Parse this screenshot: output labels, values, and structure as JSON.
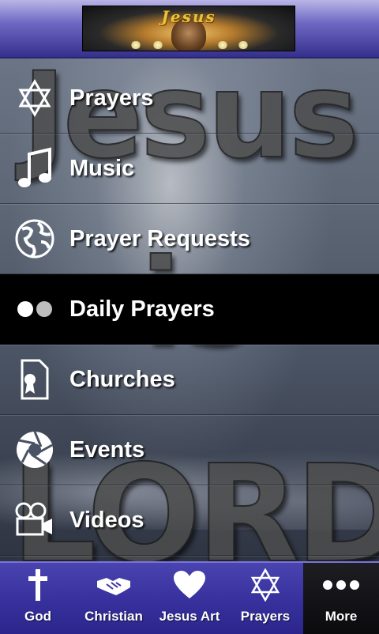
{
  "header": {
    "banner_title": "Jesus"
  },
  "background": {
    "word_top": "Jesus",
    "word_middle": "is",
    "word_bottom": "LORD"
  },
  "menu": {
    "items": [
      {
        "label": "Prayers",
        "icon": "star-of-david-icon"
      },
      {
        "label": "Music",
        "icon": "music-note-icon"
      },
      {
        "label": "Prayer Requests",
        "icon": "globe-icon"
      },
      {
        "label": "Daily Prayers",
        "icon": "dots-icon",
        "selected": true
      },
      {
        "label": "Churches",
        "icon": "document-icon"
      },
      {
        "label": "Events",
        "icon": "camera-aperture-icon"
      },
      {
        "label": "Videos",
        "icon": "video-camera-icon"
      }
    ]
  },
  "tabbar": {
    "tabs": [
      {
        "label": "God",
        "icon": "cross-icon"
      },
      {
        "label": "Christian",
        "icon": "handshake-icon"
      },
      {
        "label": "Jesus Art",
        "icon": "heart-icon"
      },
      {
        "label": "Prayers",
        "icon": "star-of-david-icon"
      },
      {
        "label": "More",
        "icon": "more-dots-icon",
        "active": true
      }
    ]
  },
  "colors": {
    "header_top": "#b9b5e6",
    "header_bottom": "#35308c",
    "tabbar": "#3a33a0",
    "selected_row": "#000000",
    "text": "#ffffff"
  }
}
